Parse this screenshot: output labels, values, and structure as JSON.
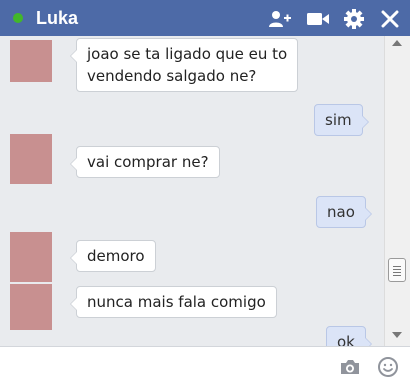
{
  "header": {
    "contact_name": "Luka",
    "online": true,
    "background_color": "#4d6aa7"
  },
  "messages": [
    {
      "direction": "received",
      "text_lines": [
        "joao se ta ligado que eu to",
        "vendendo salgado ne?"
      ]
    },
    {
      "direction": "sent",
      "text": "sim"
    },
    {
      "direction": "received",
      "text": "vai comprar ne?"
    },
    {
      "direction": "sent",
      "text": "nao"
    },
    {
      "direction": "received",
      "text": "demoro"
    },
    {
      "direction": "received",
      "text": "nunca mais fala comigo"
    },
    {
      "direction": "sent",
      "text": "ok"
    }
  ],
  "header_icons": [
    "add-people-icon",
    "video-call-icon",
    "gear-icon",
    "close-icon"
  ],
  "composer_icons": [
    "camera-icon",
    "emoji-icon"
  ],
  "colors": {
    "sent_bubble": "#dbe4f7",
    "received_bubble": "#ffffff",
    "chat_background": "#e9ebee",
    "online_dot": "#42b72a"
  }
}
